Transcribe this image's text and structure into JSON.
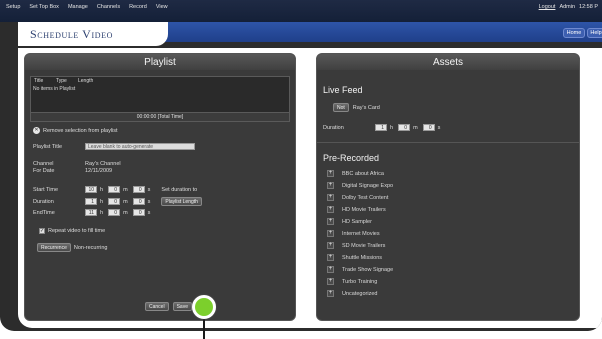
{
  "menubar": {
    "items": [
      "Setup",
      "Set Top Box",
      "Manage",
      "Channels",
      "Record",
      "View"
    ],
    "logout": "Logout",
    "user": "Admin",
    "time": "12:58 P"
  },
  "header": {
    "title": "Schedule Video",
    "home": "Home",
    "help": "Help"
  },
  "playlist": {
    "title": "Playlist",
    "columns": [
      "Title",
      "Type",
      "Length"
    ],
    "empty_text": "No items in Playlist",
    "total": "00:00:00 [Total Time]",
    "remove_label": "Remove selection from playlist",
    "title_label": "Playlist Title",
    "title_placeholder": "Leave blank to auto-generate",
    "channel_label": "Channel",
    "channel_value": "Ray's Channel",
    "date_label": "For Date",
    "date_value": "12/11/2009",
    "start_label": "Start Time",
    "start_h": "10",
    "start_m": "0",
    "start_s": "0",
    "duration_label": "Duration",
    "dur_h": "1",
    "dur_m": "0",
    "dur_s": "0",
    "end_label": "EndTime",
    "end_h": "11",
    "end_m": "0",
    "end_s": "0",
    "unit_h": "h",
    "unit_m": "m",
    "unit_s": "s",
    "set_duration_label": "Set duration to",
    "playlist_length_btn": "Playlist Length",
    "repeat_label": "Repeat video to fill time",
    "recurrence_btn": "Recurrence",
    "recurrence_value": "Non-recurring",
    "cancel_btn": "Cancel",
    "save_btn": "Save"
  },
  "assets": {
    "title": "Assets",
    "live_feed_title": "Live Feed",
    "live_feed_btn": "Not",
    "live_feed_card": "Ray's Card",
    "duration_label": "Duration",
    "dur_h": "1",
    "dur_m": "0",
    "dur_s": "0",
    "unit_h": "h",
    "unit_m": "m",
    "unit_s": "s",
    "prerecorded_title": "Pre-Recorded",
    "items": [
      "BBC about Africa",
      "Digital Signage Expo",
      "Dolby Test Content",
      "HD Movie Trailers",
      "HD Sampler",
      "Internet Movies",
      "SD Movie Trailers",
      "Shuttle Missions",
      "Trade Show Signage",
      "Turbo Training",
      "Uncategorized"
    ]
  },
  "colors": {
    "accent_blue": "#1f3f8a",
    "panel": "#3a3a3a",
    "callout": "#7ccf2c"
  }
}
